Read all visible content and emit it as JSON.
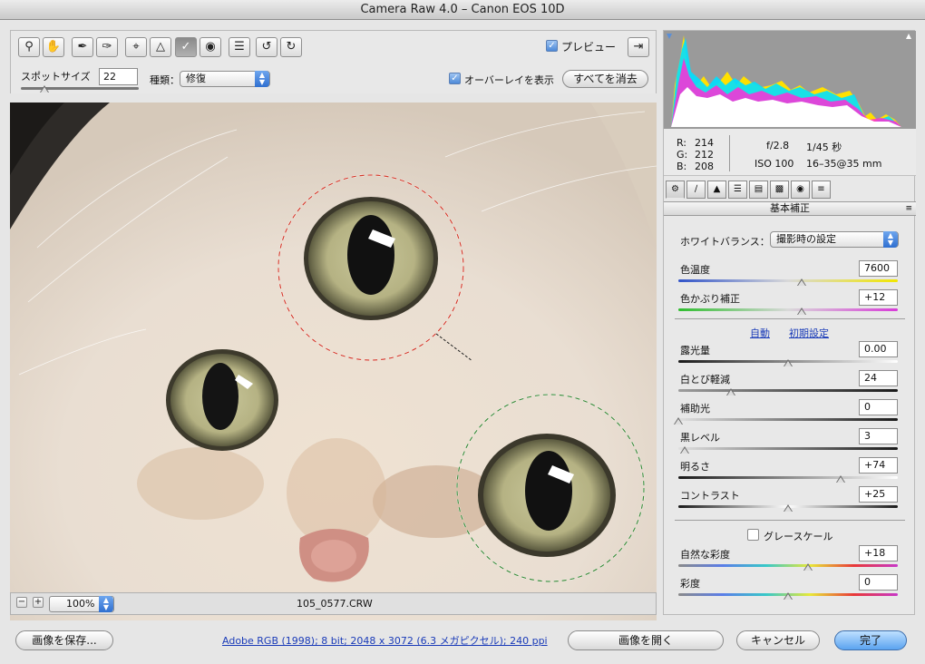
{
  "window": {
    "title": "Camera Raw 4.0  –  Canon EOS 10D"
  },
  "toolbar": {
    "tools": [
      "zoom-icon",
      "hand-icon",
      "white-balance-icon",
      "color-sampler-icon",
      "crop-icon",
      "straighten-icon",
      "spot-removal-icon",
      "red-eye-icon",
      "preferences-icon",
      "rotate-ccw-icon",
      "rotate-cw-icon"
    ],
    "preview_label": "プレビュー",
    "preview_checked": true
  },
  "options": {
    "spot_size_label": "スポットサイズ",
    "spot_size_value": "22",
    "type_label": "種類：",
    "type_value": "修復",
    "overlay_label": "オーバーレイを表示",
    "overlay_checked": true,
    "clear_all_label": "すべてを消去"
  },
  "status": {
    "zoom_value": "100%",
    "filename": "105_0577.CRW"
  },
  "readout": {
    "r_label": "R:",
    "r": "214",
    "g_label": "G:",
    "g": "212",
    "b_label": "B:",
    "b": "208",
    "aperture": "f/2.8",
    "shutter": "1/45 秒",
    "iso": "ISO 100",
    "lens": "16–35@35 mm"
  },
  "panel": {
    "title": "基本補正",
    "wb_label": "ホワイトバランス：",
    "wb_value": "撮影時の設定",
    "auto_label": "自動",
    "default_label": "初期設定",
    "grayscale_label": "グレースケール",
    "grayscale_checked": false,
    "sliders": [
      {
        "label": "色温度",
        "value": "7600",
        "level": 0.56
      },
      {
        "label": "色かぶり補正",
        "value": "+12",
        "level": 0.56
      },
      {
        "label": "露光量",
        "value": "0.00",
        "level": 0.5
      },
      {
        "label": "白とび軽減",
        "value": "24",
        "level": 0.24
      },
      {
        "label": "補助光",
        "value": "0",
        "level": 0.0
      },
      {
        "label": "黒レベル",
        "value": "3",
        "level": 0.03
      },
      {
        "label": "明るさ",
        "value": "+74",
        "level": 0.74
      },
      {
        "label": "コントラスト",
        "value": "+25",
        "level": 0.5
      },
      {
        "label": "自然な彩度",
        "value": "+18",
        "level": 0.59
      },
      {
        "label": "彩度",
        "value": "0",
        "level": 0.5
      }
    ]
  },
  "footer": {
    "save_label": "画像を保存...",
    "workflow_link": "Adobe RGB (1998); 8 bit; 2048 x 3072 (6.3 メガピクセル); 240 ppi",
    "open_label": "画像を開く",
    "cancel_label": "キャンセル",
    "done_label": "完了"
  },
  "colors": {
    "accent": "#4d8ad8",
    "link": "#1a3bb8",
    "source_circle": "#d23a2a",
    "target_circle": "#3f8a3a"
  }
}
